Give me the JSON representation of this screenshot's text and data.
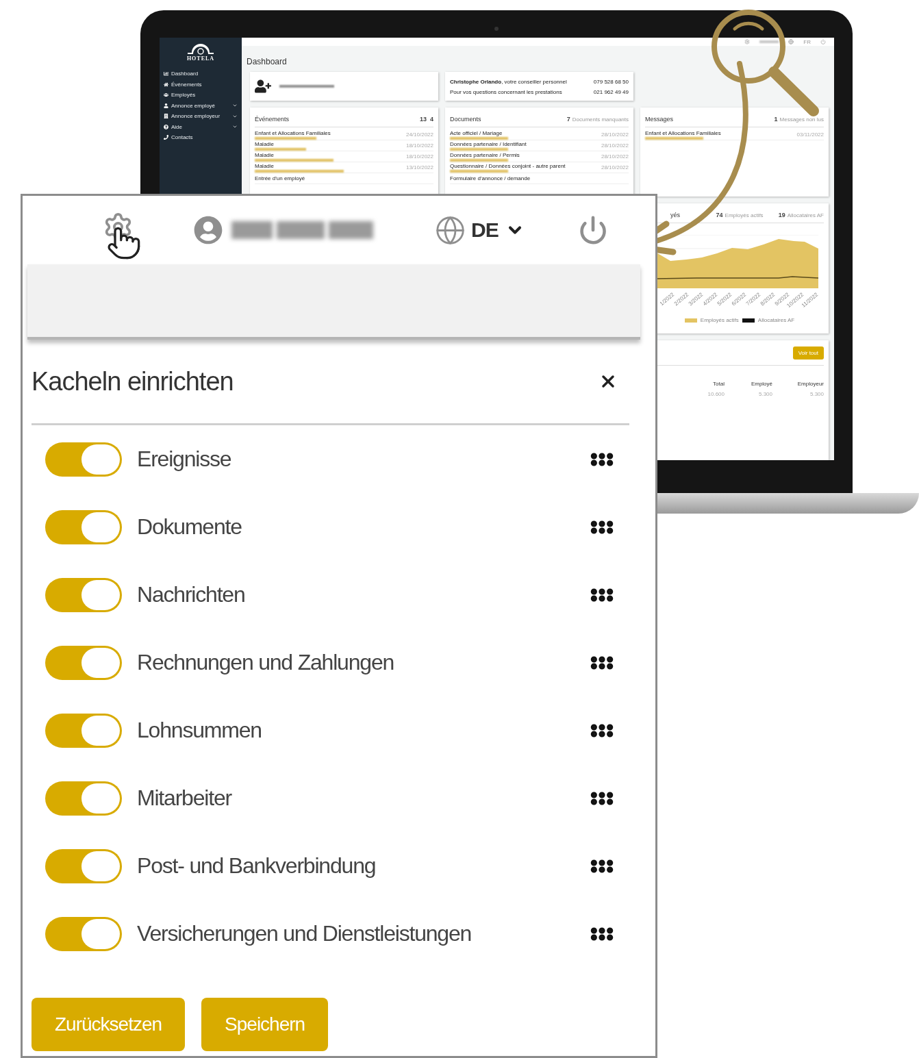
{
  "laptop": {
    "sidebar": {
      "logo": "HOTELA",
      "items": [
        {
          "label": "Dashboard",
          "kind": "chart",
          "has_submenu": false
        },
        {
          "label": "Événements",
          "kind": "home",
          "has_submenu": false
        },
        {
          "label": "Employés",
          "kind": "users",
          "has_submenu": false
        },
        {
          "label": "Annonce employé",
          "kind": "user",
          "has_submenu": true
        },
        {
          "label": "Annonce employeur",
          "kind": "building",
          "has_submenu": true
        },
        {
          "label": "Aide",
          "kind": "help",
          "has_submenu": true
        },
        {
          "label": "Contacts",
          "kind": "phone",
          "has_submenu": false
        }
      ]
    },
    "topbar": {
      "language": "FR"
    },
    "page_title": "Dashboard",
    "advisor": {
      "name": "Christophe Orlando",
      "role": ", votre conseiller personnel",
      "phone": "079 528 68 50",
      "note": "Pour vos questions concernant les prestations",
      "phone_2": "021 962 49 49"
    },
    "events": {
      "title": "Événements",
      "count": "13",
      "count_2": "4",
      "items": [
        {
          "title": "Enfant et Allocations Familiales",
          "date": "24/10/2022"
        },
        {
          "title": "Maladie",
          "date": "18/10/2022"
        },
        {
          "title": "Maladie",
          "date": "18/10/2022"
        },
        {
          "title": "Maladie",
          "date": "13/10/2022"
        },
        {
          "title": "Entrée d'un employé"
        }
      ]
    },
    "documents": {
      "title": "Documents",
      "count": "7",
      "count_label": "Documents manquants",
      "items": [
        {
          "title": "Acte officiel / Mariage",
          "date": "28/10/2022"
        },
        {
          "title": "Données partenaire / Identifiant",
          "date": "28/10/2022"
        },
        {
          "title": "Données partenaire / Permis",
          "date": "28/10/2022"
        },
        {
          "title": "Questionnaire / Données conjoint - autre parent",
          "date": "28/10/2022"
        },
        {
          "title": "Formulaire d'annonce / demande"
        }
      ]
    },
    "messages": {
      "title": "Messages",
      "count": "1",
      "count_label": "Messages non lus",
      "items": [
        {
          "title": "Enfant et Allocations Familiales",
          "date": "03/11/2022"
        }
      ]
    },
    "chart_card": {
      "title_fragment": "yés",
      "stats": [
        {
          "value": "74",
          "label": "Employés actifs"
        },
        {
          "value": "19",
          "label": "Allocataires AF"
        }
      ],
      "x_labels": [
        "1/2022",
        "2/2022",
        "3/2022",
        "4/2022",
        "5/2022",
        "6/2022",
        "7/2022",
        "8/2022",
        "9/2022",
        "10/2022",
        "11/2022"
      ],
      "legend": [
        {
          "label": "Employés actifs",
          "color": "#e3c463"
        },
        {
          "label": "Allocataires AF",
          "color": "#111111"
        }
      ]
    },
    "table_card": {
      "button": "Voir tout",
      "columns": [
        "Total",
        "Employé",
        "Employeur"
      ],
      "rows": [
        [
          "10.600",
          "5.300",
          "5.300"
        ]
      ]
    }
  },
  "panel": {
    "language": "DE",
    "title": "Kacheln einrichten",
    "tiles": [
      {
        "label": "Ereignisse",
        "on": true
      },
      {
        "label": "Dokumente",
        "on": true
      },
      {
        "label": "Nachrichten",
        "on": true
      },
      {
        "label": "Rechnungen und Zahlungen",
        "on": true
      },
      {
        "label": "Lohnsummen",
        "on": true
      },
      {
        "label": "Mitarbeiter",
        "on": true
      },
      {
        "label": "Post- und Bankverbindung",
        "on": true
      },
      {
        "label": "Versicherungen und Dienstleistungen",
        "on": true
      }
    ],
    "buttons": [
      "Zurücksetzen",
      "Speichern"
    ]
  }
}
